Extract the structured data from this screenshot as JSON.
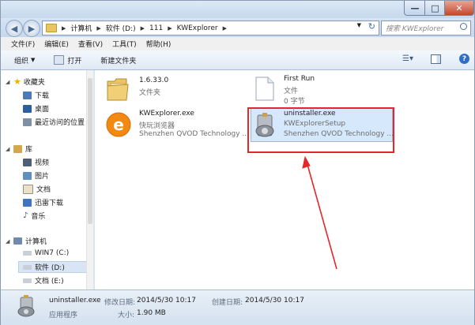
{
  "window": {
    "controls": {
      "minimize": "—",
      "maximize": "□",
      "close": "✕"
    }
  },
  "address": {
    "path": [
      "计算机",
      "软件 (D:)",
      "111",
      "KWExplorer"
    ],
    "search_placeholder": "搜索 KWExplorer"
  },
  "menu": [
    "文件(F)",
    "编辑(E)",
    "查看(V)",
    "工具(T)",
    "帮助(H)"
  ],
  "toolbar": {
    "organize": "组织",
    "open": "打开",
    "new_folder": "新建文件夹"
  },
  "sidebar": {
    "favorites": "收藏夹",
    "fav_items": [
      "下载",
      "桌面",
      "最近访问的位置"
    ],
    "library": "库",
    "lib_items": [
      "视频",
      "图片",
      "文档",
      "迅雷下载",
      "音乐"
    ],
    "computer": "计算机",
    "drives": [
      "WIN7 (C:)",
      "软件 (D:)",
      "文档 (E:)"
    ]
  },
  "files": [
    {
      "name": "1.6.33.0",
      "l2": "文件夹",
      "l3": ""
    },
    {
      "name": "First Run",
      "l2": "文件",
      "l3": "0 字节"
    },
    {
      "name": "KWExplorer.exe",
      "l2": "快玩浏览器",
      "l3": "Shenzhen QVOD Technology ..."
    },
    {
      "name": "uninstaller.exe",
      "l2": "KWExplorerSetup",
      "l3": "Shenzhen QVOD Technology ..."
    }
  ],
  "status": {
    "name": "uninstaller.exe",
    "type": "应用程序",
    "modified_label": "修改日期:",
    "modified": "2014/5/30 10:17",
    "created_label": "创建日期:",
    "created": "2014/5/30 10:17",
    "size_label": "大小:",
    "size": "1.90 MB"
  },
  "colors": {
    "highlight": "#e5262a",
    "selection": "#d6e8fb",
    "accent": "#2f6fc9"
  }
}
